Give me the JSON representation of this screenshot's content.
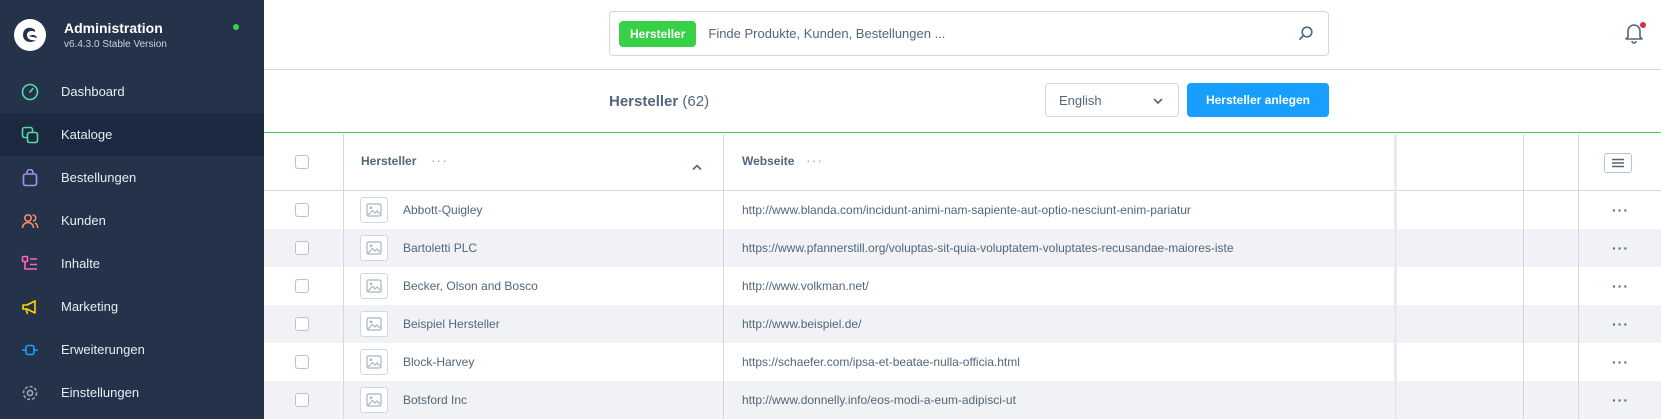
{
  "app": {
    "title": "Administration",
    "version": "v6.4.3.0 Stable Version"
  },
  "colors": {
    "sidebar_bg": "#25334a",
    "accent_green": "#37d046",
    "primary_blue": "#189eff",
    "notification_red": "#de294c"
  },
  "sidebar": {
    "items": [
      {
        "label": "Dashboard",
        "icon": "gauge-icon",
        "color": "#57d9a3"
      },
      {
        "label": "Kataloge",
        "icon": "products-icon",
        "color": "#57d9a3",
        "active": true
      },
      {
        "label": "Bestellungen",
        "icon": "shopping-bag-icon",
        "color": "#a092f0"
      },
      {
        "label": "Kunden",
        "icon": "users-icon",
        "color": "#f88962"
      },
      {
        "label": "Inhalte",
        "icon": "content-icon",
        "color": "#ff68b4"
      },
      {
        "label": "Marketing",
        "icon": "megaphone-icon",
        "color": "#ffd700"
      },
      {
        "label": "Erweiterungen",
        "icon": "plug-icon",
        "color": "#189eff"
      },
      {
        "label": "Einstellungen",
        "icon": "gear-icon",
        "color": "#9aa8b5"
      }
    ]
  },
  "search": {
    "badge": "Hersteller",
    "placeholder": "Finde Produkte, Kunden, Bestellungen ..."
  },
  "header": {
    "title": "Hersteller",
    "count": "(62)",
    "language": "English",
    "create_button": "Hersteller anlegen"
  },
  "table": {
    "columns": {
      "name": "Hersteller",
      "website": "Webseite",
      "more": "···"
    },
    "rows": [
      {
        "name": "Abbott-Quigley",
        "website": "http://www.blanda.com/incidunt-animi-nam-sapiente-aut-optio-nesciunt-enim-pariatur"
      },
      {
        "name": "Bartoletti PLC",
        "website": "https://www.pfannerstill.org/voluptas-sit-quia-voluptatem-voluptates-recusandae-maiores-iste"
      },
      {
        "name": "Becker, Olson and Bosco",
        "website": "http://www.volkman.net/"
      },
      {
        "name": "Beispiel Hersteller",
        "website": "http://www.beispiel.de/"
      },
      {
        "name": "Block-Harvey",
        "website": "https://schaefer.com/ipsa-et-beatae-nulla-officia.html"
      },
      {
        "name": "Botsford Inc",
        "website": "http://www.donnelly.info/eos-modi-a-eum-adipisci-ut"
      }
    ],
    "row_action": "···"
  }
}
